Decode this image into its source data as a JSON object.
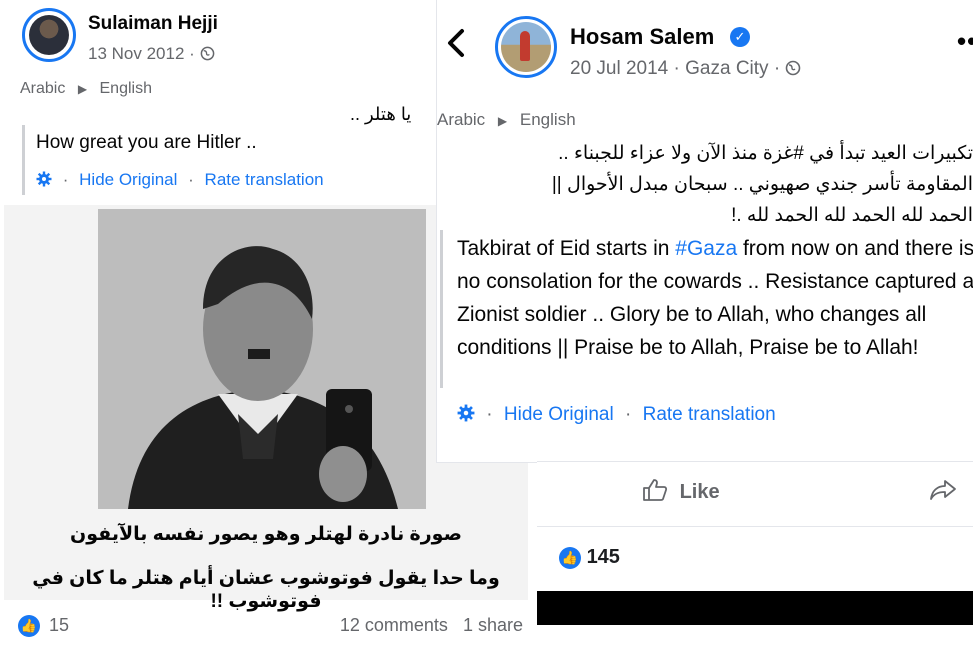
{
  "left_post": {
    "author": "Sulaiman Hejji",
    "date": "13 Nov 2012 ·",
    "lang_from": "Arabic",
    "lang_arrow": "▶",
    "lang_to": "English",
    "original_text": "يا هتلر ..",
    "translation": "How great you are Hitler ..",
    "hide_original": "Hide Original",
    "rate_translation": "Rate translation",
    "meme_caption_line1": "صورة نادرة لهتلر وهو يصور نفسه بالآيفون",
    "meme_caption_line2": "وما حدا يقول فوتوشوب عشان أيام هتلر ما كان في فوتوشوب !!",
    "reactions_count": "15",
    "comments": "12 comments",
    "shares": "1 share"
  },
  "right_post": {
    "author": "Hosam Salem",
    "date": "20 Jul 2014 ·",
    "location": "Gaza City ·",
    "lang_from": "Arabic",
    "lang_arrow": "▶",
    "lang_to": "English",
    "original_line1": "تكبيرات العيد تبدأ في #غزة منذ الآن ولا عزاء للجبناء ..",
    "original_line2": "المقاومة تأسر جندي صهيوني .. سبحان مبدل الأحوال ||",
    "original_line3": "الحمد لله الحمد لله الحمد لله .!",
    "translation_before_tag": "Takbirat of Eid starts in ",
    "translation_tag": "#Gaza",
    "translation_after_tag": " from now on and there is no consolation for the cowards .. Resistance captured a Zionist soldier .. Glory be to Allah, who changes all conditions || Praise be to Allah, Praise be to Allah!",
    "hide_original": "Hide Original",
    "rate_translation": "Rate translation",
    "like_label": "Like",
    "reactions_count": "145"
  },
  "icons": {
    "globe": "globe-icon",
    "gear": "gear-icon",
    "verified": "verified-badge-icon",
    "back": "chevron-left-icon",
    "more": "more-options-icon",
    "like": "thumbs-up-icon",
    "share": "share-arrow-icon"
  },
  "colors": {
    "accent": "#1877f2",
    "secondary_text": "#65676b"
  }
}
